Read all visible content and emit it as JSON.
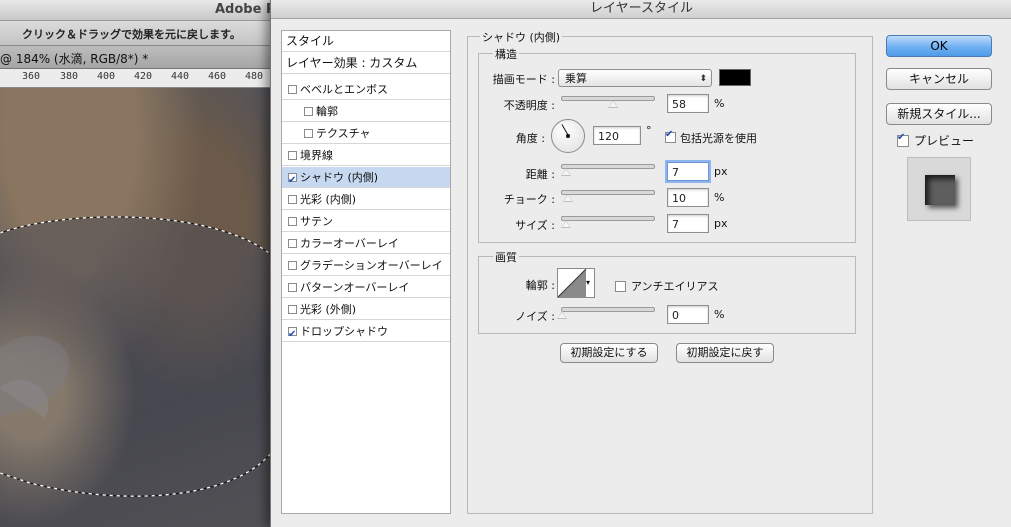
{
  "photoshop": {
    "app_title": "Adobe P",
    "hint": "クリック＆ドラッグで効果を元に戻します。",
    "doc_tab": "@ 184% (水滴, RGB/8*) *",
    "ruler": [
      "360",
      "380",
      "400",
      "420",
      "440",
      "460",
      "480"
    ]
  },
  "dialog": {
    "title": "レイヤースタイル",
    "styles_list": [
      {
        "label": "スタイル",
        "type": "header"
      },
      {
        "label": "レイヤー効果 : カスタム",
        "type": "header"
      },
      {
        "label": "ベベルとエンボス",
        "checked": false
      },
      {
        "label": "輪郭",
        "checked": false,
        "indent": true
      },
      {
        "label": "テクスチャ",
        "checked": false,
        "indent": true
      },
      {
        "label": "境界線",
        "checked": false
      },
      {
        "label": "シャドウ (内側)",
        "checked": true,
        "selected": true
      },
      {
        "label": "光彩 (内側)",
        "checked": false
      },
      {
        "label": "サテン",
        "checked": false
      },
      {
        "label": "カラーオーバーレイ",
        "checked": false
      },
      {
        "label": "グラデーションオーバーレイ",
        "checked": false
      },
      {
        "label": "パターンオーバーレイ",
        "checked": false
      },
      {
        "label": "光彩 (外側)",
        "checked": false
      },
      {
        "label": "ドロップシャドウ",
        "checked": true
      }
    ],
    "panel_title": "シャドウ (内側)",
    "structure": {
      "legend": "構造",
      "blend_mode_label": "描画モード :",
      "blend_mode_value": "乗算",
      "shadow_color": "#000000",
      "opacity_label": "不透明度 :",
      "opacity_value": "58",
      "opacity_unit": "%",
      "angle_label": "角度 :",
      "angle_value": "120",
      "angle_unit": "°",
      "global_light_label": "包括光源を使用",
      "global_light_checked": true,
      "distance_label": "距離 :",
      "distance_value": "7",
      "distance_unit": "px",
      "choke_label": "チョーク :",
      "choke_value": "10",
      "choke_unit": "%",
      "size_label": "サイズ :",
      "size_value": "7",
      "size_unit": "px"
    },
    "quality": {
      "legend": "画質",
      "contour_label": "輪郭 :",
      "anti_alias_label": "アンチエイリアス",
      "anti_alias_checked": false,
      "noise_label": "ノイズ :",
      "noise_value": "0",
      "noise_unit": "%"
    },
    "make_default_button": "初期設定にする",
    "reset_default_button": "初期設定に戻す",
    "ok_button": "OK",
    "cancel_button": "キャンセル",
    "new_style_button": "新規スタイル...",
    "preview_label": "プレビュー",
    "preview_checked": true
  }
}
